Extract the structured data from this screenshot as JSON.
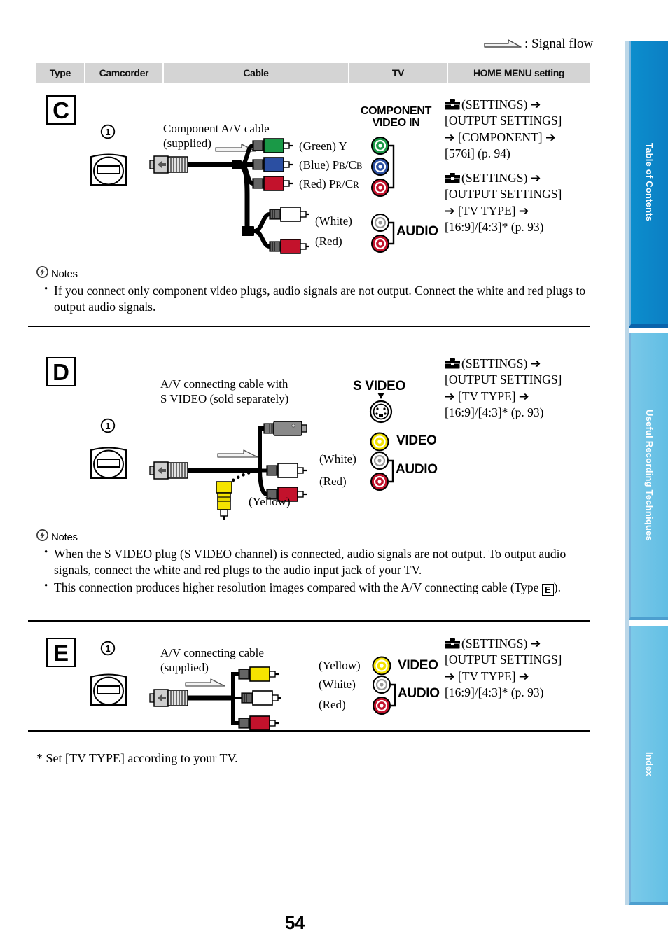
{
  "document": {
    "page_number": "54",
    "legend": {
      "label": ": Signal flow",
      "icon": "signal-flow-arrow-icon"
    },
    "footnote": "*  Set [TV TYPE] according to your TV."
  },
  "table": {
    "headers": [
      "Type",
      "Camcorder",
      "Cable",
      "TV",
      "HOME MENU setting"
    ]
  },
  "sections": [
    {
      "type": "C",
      "camcorder": {
        "callout": "1",
        "icon": "av-remote-connector-icon"
      },
      "cable": {
        "name_line1": "Component A/V cable",
        "name_line2": "(supplied)",
        "plugs": [
          {
            "color": "green",
            "label": "(Green) Y"
          },
          {
            "color": "blue",
            "label": "(Blue) PB/CB"
          },
          {
            "color": "red",
            "label": "(Red) PR/CR"
          },
          {
            "color": "white",
            "label": "(White)"
          },
          {
            "color": "red",
            "label": "(Red)"
          }
        ]
      },
      "tv": {
        "group1_label_line1": "COMPONENT",
        "group1_label_line2": "VIDEO IN",
        "group2_label": "AUDIO"
      },
      "menu": [
        {
          "icon": "toolbox-icon",
          "text": "(SETTINGS) → [OUTPUT SETTINGS] → [COMPONENT] → [576i] (p. 94)"
        },
        {
          "icon": "toolbox-icon",
          "text": "(SETTINGS) → [OUTPUT SETTINGS] → [TV TYPE] → [16:9]/[4:3]* (p. 93)"
        }
      ],
      "notes": {
        "title": "Notes",
        "items": [
          "If you connect only component video plugs, audio signals are not output. Connect the white and red plugs to output audio signals."
        ]
      }
    },
    {
      "type": "D",
      "camcorder": {
        "callout": "1",
        "icon": "av-remote-connector-icon"
      },
      "cable": {
        "name_line1": "A/V connecting cable with",
        "name_line2": "S VIDEO (sold separately)",
        "plugs": [
          {
            "color": "gray",
            "label": ""
          },
          {
            "color": "white",
            "label": "(White)"
          },
          {
            "color": "red",
            "label": "(Red)"
          },
          {
            "color": "yellow",
            "label": "(Yellow)"
          }
        ]
      },
      "tv": {
        "svideo_label": "S VIDEO",
        "video_label": "VIDEO",
        "audio_label": "AUDIO"
      },
      "menu": [
        {
          "icon": "toolbox-icon",
          "text": "(SETTINGS) → [OUTPUT SETTINGS] → [TV TYPE] → [16:9]/[4:3]* (p. 93)"
        }
      ],
      "notes": {
        "title": "Notes",
        "items": [
          "When the S VIDEO plug (S VIDEO channel) is connected, audio signals are not output. To output audio signals, connect the white and red plugs to the audio input jack of your TV.",
          "This connection produces higher resolution images compared with the A/V connecting cable (Type E)."
        ]
      }
    },
    {
      "type": "E",
      "camcorder": {
        "callout": "1",
        "icon": "av-remote-connector-icon"
      },
      "cable": {
        "name_line1": "A/V connecting cable",
        "name_line2": "(supplied)",
        "plugs": [
          {
            "color": "yellow",
            "label": "(Yellow)"
          },
          {
            "color": "white",
            "label": "(White)"
          },
          {
            "color": "red",
            "label": "(Red)"
          }
        ]
      },
      "tv": {
        "video_label": "VIDEO",
        "audio_label": "AUDIO"
      },
      "menu": [
        {
          "icon": "toolbox-icon",
          "text": "(SETTINGS) → [OUTPUT SETTINGS] → [TV TYPE] → [16:9]/[4:3]* (p. 93)"
        }
      ]
    }
  ],
  "menu_text": {
    "c1_l1": "(SETTINGS) ➔",
    "c1_l2": "[OUTPUT SETTINGS]",
    "c1_l3": "➔ [COMPONENT] ➔",
    "c1_l4": "[576i] (p. 94)",
    "c2_l1": "(SETTINGS) ➔",
    "c2_l2": "[OUTPUT SETTINGS]",
    "c2_l3": "➔ [TV TYPE] ➔",
    "c2_l4": "[16:9]/[4:3]* (p. 93)"
  },
  "sidebar": {
    "tabs": [
      {
        "label": "Table of Contents",
        "active": true,
        "color": "#0b82c7"
      },
      {
        "label": "Useful Recording Techniques",
        "active": false,
        "color": "#6cc3e6"
      },
      {
        "label": "Index",
        "active": false,
        "color": "#6cc3e6"
      }
    ]
  },
  "colors": {
    "header_bg": "#d4d4d4",
    "plug_green": "#1a9947",
    "plug_blue": "#2b4fa2",
    "plug_red": "#c3122c",
    "plug_yellow": "#f5e400",
    "plug_white": "#ffffff",
    "plug_gray": "#8a8a8a",
    "tab_active": "#0b82c7",
    "tab_inactive": "#6cc3e6"
  }
}
